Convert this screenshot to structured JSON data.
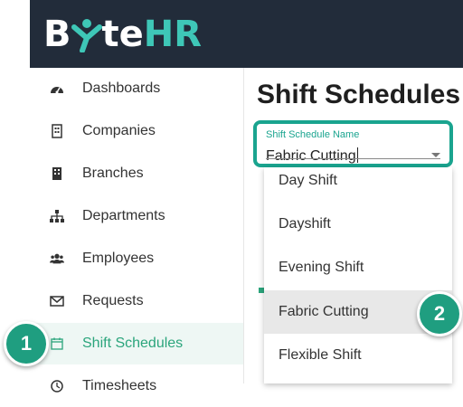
{
  "brand": {
    "logo_b": "B",
    "logo_te": "te",
    "logo_hr": "HR"
  },
  "sidebar": {
    "items": [
      {
        "label": "Dashboards",
        "icon": "dashboard-icon"
      },
      {
        "label": "Companies",
        "icon": "building-icon"
      },
      {
        "label": "Branches",
        "icon": "branch-building-icon"
      },
      {
        "label": "Departments",
        "icon": "sitemap-icon"
      },
      {
        "label": "Employees",
        "icon": "users-icon"
      },
      {
        "label": "Requests",
        "icon": "envelope-icon"
      },
      {
        "label": "Shift Schedules",
        "icon": "calendar-icon",
        "active": true
      },
      {
        "label": "Timesheets",
        "icon": "clock-icon"
      }
    ],
    "partial_label": "Timesheets"
  },
  "main": {
    "title": "Shift Schedules",
    "field": {
      "label": "Shift Schedule Name",
      "value": "Fabric Cutting"
    }
  },
  "dropdown": {
    "options": [
      "Day Shift",
      "Dayshift",
      "Evening Shift",
      "Fabric Cutting",
      "Flexible Shift"
    ],
    "highlighted": "Fabric Cutting"
  },
  "badges": {
    "one": "1",
    "two": "2"
  },
  "colors": {
    "header_bg": "#222c3a",
    "accent": "#1aa48f",
    "active_text": "#2ba57c",
    "badge": "#1f9e80"
  }
}
